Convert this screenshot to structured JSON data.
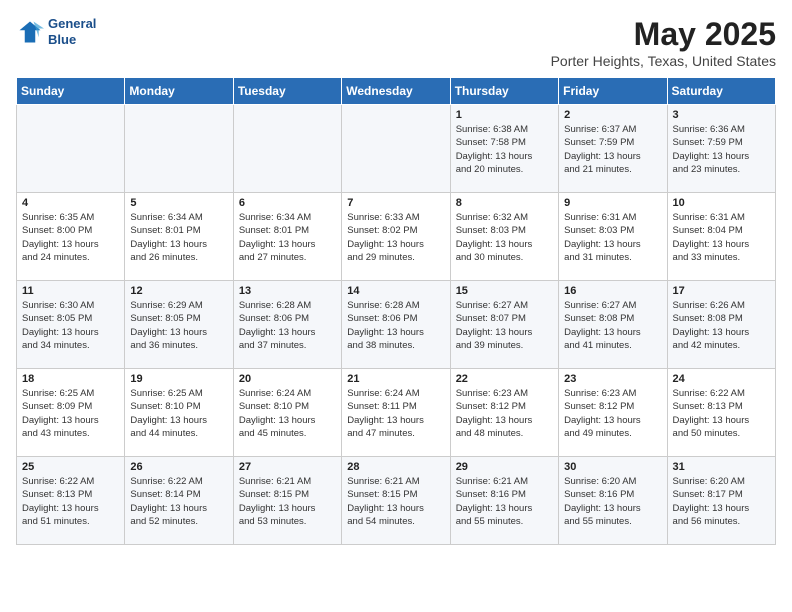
{
  "header": {
    "logo_line1": "General",
    "logo_line2": "Blue",
    "title": "May 2025",
    "subtitle": "Porter Heights, Texas, United States"
  },
  "weekdays": [
    "Sunday",
    "Monday",
    "Tuesday",
    "Wednesday",
    "Thursday",
    "Friday",
    "Saturday"
  ],
  "weeks": [
    [
      {
        "day": "",
        "info": ""
      },
      {
        "day": "",
        "info": ""
      },
      {
        "day": "",
        "info": ""
      },
      {
        "day": "",
        "info": ""
      },
      {
        "day": "1",
        "info": "Sunrise: 6:38 AM\nSunset: 7:58 PM\nDaylight: 13 hours\nand 20 minutes."
      },
      {
        "day": "2",
        "info": "Sunrise: 6:37 AM\nSunset: 7:59 PM\nDaylight: 13 hours\nand 21 minutes."
      },
      {
        "day": "3",
        "info": "Sunrise: 6:36 AM\nSunset: 7:59 PM\nDaylight: 13 hours\nand 23 minutes."
      }
    ],
    [
      {
        "day": "4",
        "info": "Sunrise: 6:35 AM\nSunset: 8:00 PM\nDaylight: 13 hours\nand 24 minutes."
      },
      {
        "day": "5",
        "info": "Sunrise: 6:34 AM\nSunset: 8:01 PM\nDaylight: 13 hours\nand 26 minutes."
      },
      {
        "day": "6",
        "info": "Sunrise: 6:34 AM\nSunset: 8:01 PM\nDaylight: 13 hours\nand 27 minutes."
      },
      {
        "day": "7",
        "info": "Sunrise: 6:33 AM\nSunset: 8:02 PM\nDaylight: 13 hours\nand 29 minutes."
      },
      {
        "day": "8",
        "info": "Sunrise: 6:32 AM\nSunset: 8:03 PM\nDaylight: 13 hours\nand 30 minutes."
      },
      {
        "day": "9",
        "info": "Sunrise: 6:31 AM\nSunset: 8:03 PM\nDaylight: 13 hours\nand 31 minutes."
      },
      {
        "day": "10",
        "info": "Sunrise: 6:31 AM\nSunset: 8:04 PM\nDaylight: 13 hours\nand 33 minutes."
      }
    ],
    [
      {
        "day": "11",
        "info": "Sunrise: 6:30 AM\nSunset: 8:05 PM\nDaylight: 13 hours\nand 34 minutes."
      },
      {
        "day": "12",
        "info": "Sunrise: 6:29 AM\nSunset: 8:05 PM\nDaylight: 13 hours\nand 36 minutes."
      },
      {
        "day": "13",
        "info": "Sunrise: 6:28 AM\nSunset: 8:06 PM\nDaylight: 13 hours\nand 37 minutes."
      },
      {
        "day": "14",
        "info": "Sunrise: 6:28 AM\nSunset: 8:06 PM\nDaylight: 13 hours\nand 38 minutes."
      },
      {
        "day": "15",
        "info": "Sunrise: 6:27 AM\nSunset: 8:07 PM\nDaylight: 13 hours\nand 39 minutes."
      },
      {
        "day": "16",
        "info": "Sunrise: 6:27 AM\nSunset: 8:08 PM\nDaylight: 13 hours\nand 41 minutes."
      },
      {
        "day": "17",
        "info": "Sunrise: 6:26 AM\nSunset: 8:08 PM\nDaylight: 13 hours\nand 42 minutes."
      }
    ],
    [
      {
        "day": "18",
        "info": "Sunrise: 6:25 AM\nSunset: 8:09 PM\nDaylight: 13 hours\nand 43 minutes."
      },
      {
        "day": "19",
        "info": "Sunrise: 6:25 AM\nSunset: 8:10 PM\nDaylight: 13 hours\nand 44 minutes."
      },
      {
        "day": "20",
        "info": "Sunrise: 6:24 AM\nSunset: 8:10 PM\nDaylight: 13 hours\nand 45 minutes."
      },
      {
        "day": "21",
        "info": "Sunrise: 6:24 AM\nSunset: 8:11 PM\nDaylight: 13 hours\nand 47 minutes."
      },
      {
        "day": "22",
        "info": "Sunrise: 6:23 AM\nSunset: 8:12 PM\nDaylight: 13 hours\nand 48 minutes."
      },
      {
        "day": "23",
        "info": "Sunrise: 6:23 AM\nSunset: 8:12 PM\nDaylight: 13 hours\nand 49 minutes."
      },
      {
        "day": "24",
        "info": "Sunrise: 6:22 AM\nSunset: 8:13 PM\nDaylight: 13 hours\nand 50 minutes."
      }
    ],
    [
      {
        "day": "25",
        "info": "Sunrise: 6:22 AM\nSunset: 8:13 PM\nDaylight: 13 hours\nand 51 minutes."
      },
      {
        "day": "26",
        "info": "Sunrise: 6:22 AM\nSunset: 8:14 PM\nDaylight: 13 hours\nand 52 minutes."
      },
      {
        "day": "27",
        "info": "Sunrise: 6:21 AM\nSunset: 8:15 PM\nDaylight: 13 hours\nand 53 minutes."
      },
      {
        "day": "28",
        "info": "Sunrise: 6:21 AM\nSunset: 8:15 PM\nDaylight: 13 hours\nand 54 minutes."
      },
      {
        "day": "29",
        "info": "Sunrise: 6:21 AM\nSunset: 8:16 PM\nDaylight: 13 hours\nand 55 minutes."
      },
      {
        "day": "30",
        "info": "Sunrise: 6:20 AM\nSunset: 8:16 PM\nDaylight: 13 hours\nand 55 minutes."
      },
      {
        "day": "31",
        "info": "Sunrise: 6:20 AM\nSunset: 8:17 PM\nDaylight: 13 hours\nand 56 minutes."
      }
    ]
  ]
}
